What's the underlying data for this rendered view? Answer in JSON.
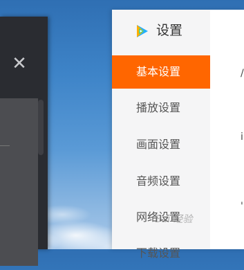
{
  "player": {
    "close_icon": "close-icon"
  },
  "settings": {
    "title": "设置",
    "logo": "tencent-video-logo",
    "menu": [
      {
        "label": "基本设置",
        "active": true
      },
      {
        "label": "播放设置",
        "active": false
      },
      {
        "label": "画面设置",
        "active": false
      },
      {
        "label": "音频设置",
        "active": false
      },
      {
        "label": "网络设置",
        "active": false
      },
      {
        "label": "下载设置",
        "active": false
      }
    ],
    "accent_color": "#ff6600"
  },
  "watermark": "Bai 经验"
}
